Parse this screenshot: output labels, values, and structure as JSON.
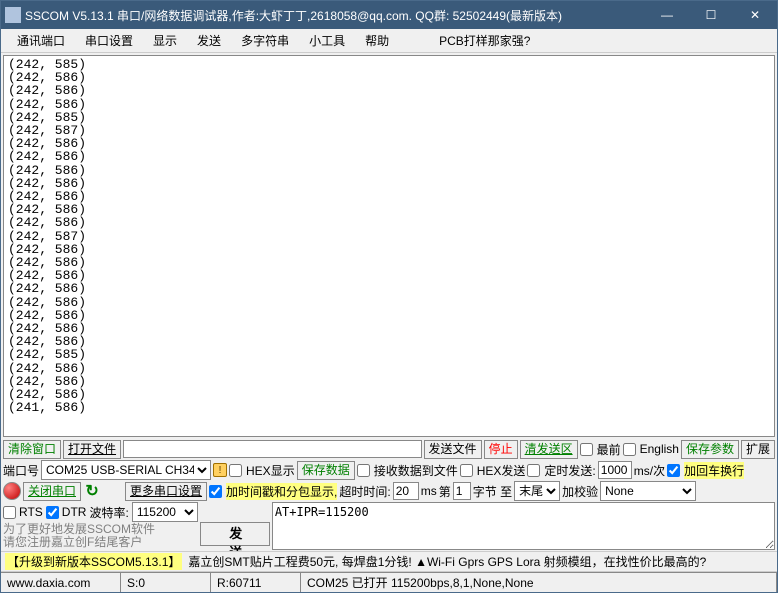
{
  "title": "SSCOM V5.13.1 串口/网络数据调试器,作者:大虾丁丁,2618058@qq.com. QQ群: 52502449(最新版本)",
  "menu": [
    "通讯端口",
    "串口设置",
    "显示",
    "发送",
    "多字符串",
    "小工具",
    "帮助",
    "PCB打样那家强?"
  ],
  "output_lines": "(242, 585)\n(242, 586)\n(242, 586)\n(242, 586)\n(242, 585)\n(242, 587)\n(242, 586)\n(242, 586)\n(242, 586)\n(242, 586)\n(242, 586)\n(242, 586)\n(242, 586)\n(242, 587)\n(242, 586)\n(242, 586)\n(242, 586)\n(242, 586)\n(242, 586)\n(242, 586)\n(242, 586)\n(242, 586)\n(242, 585)\n(242, 586)\n(242, 586)\n(242, 586)\n(241, 586)",
  "row1": {
    "clear_window": "清除窗口",
    "open_file": "打开文件",
    "send_file": "发送文件",
    "stop": "停止",
    "clear_send": "清发送区",
    "top_most": "最前",
    "english": "English",
    "save_params": "保存参数",
    "extend": "扩展"
  },
  "row2": {
    "port_label": "端口号",
    "port_value": "COM25 USB-SERIAL CH340",
    "hex_show": "HEX显示",
    "save_data": "保存数据",
    "recv_to_file": "接收数据到文件",
    "hex_send": "HEX发送",
    "timed_send": "定时发送:",
    "interval": "1000",
    "interval_unit": "ms/次",
    "add_crlf": "加回车换行"
  },
  "row3": {
    "close_port": "关闭串口",
    "more_settings": "更多串口设置",
    "add_timestamp": "加时间戳和分包显示,",
    "timeout_label": "超时时间:",
    "timeout": "20",
    "timeout_unit": "ms",
    "nth_label": "第",
    "nth": "1",
    "nth_unit": "字节 至",
    "end_sel": "末尾",
    "check_label": "加校验",
    "check_sel": "None"
  },
  "row4": {
    "rts": "RTS",
    "dtr": "DTR",
    "baud_label": "波特率:",
    "baud": "115200",
    "cmd": "AT+IPR=115200"
  },
  "promo_left_1": "为了更好地发展SSCOM软件",
  "promo_left_2": "请您注册嘉立创F结尾客户",
  "send_btn": "发  送",
  "promo_bar": {
    "tag": "【升级到新版本SSCOM5.13.1】",
    "text": "嘉立创SMT贴片工程费50元, 每焊盘1分钱!  ▲Wi-Fi Gprs GPS Lora 射频模组，在找性价比最高的?"
  },
  "status": {
    "site": "www.daxia.com",
    "s": "S:0",
    "r": "R:60711",
    "conn": "COM25 已打开 115200bps,8,1,None,None"
  }
}
